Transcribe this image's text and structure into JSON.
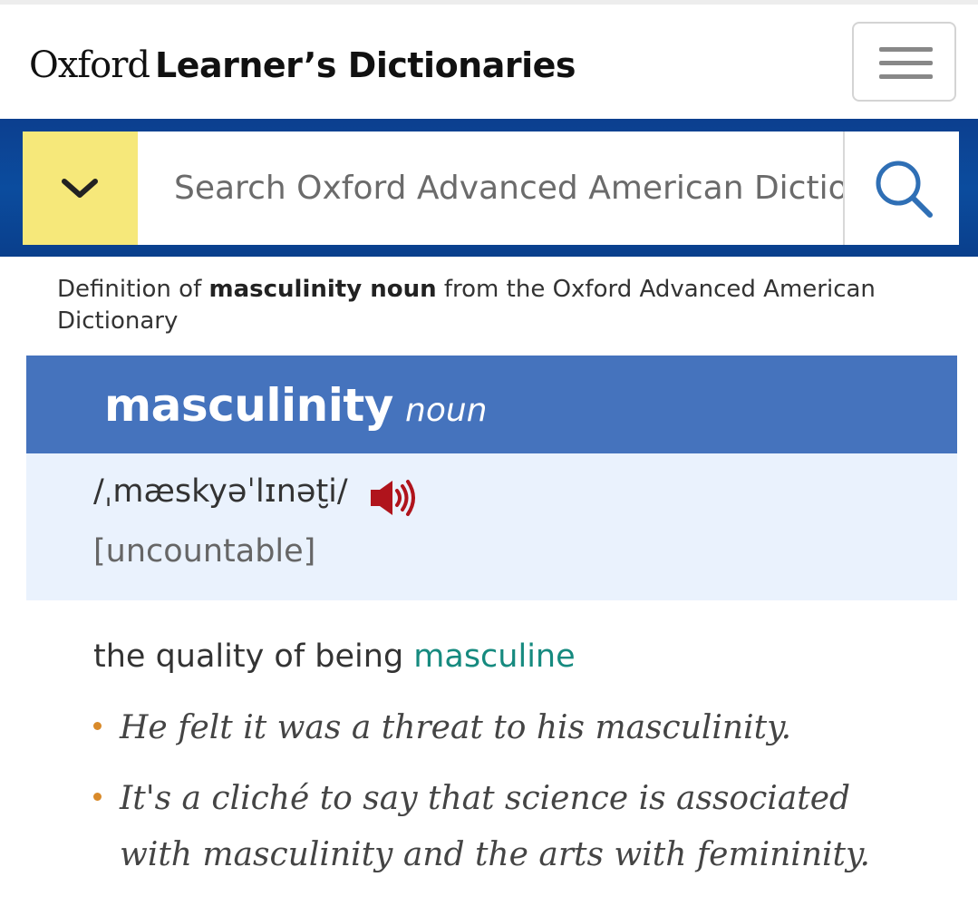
{
  "header": {
    "logo_oxford": "Oxford",
    "logo_rest": "Learner’s Dictionaries",
    "menu_icon": "hamburger-menu-icon"
  },
  "search": {
    "placeholder": "Search Oxford Advanced American Dictionary",
    "dictionary_select_icon": "chevron-down-icon",
    "search_icon": "magnifier-icon"
  },
  "definition_source": {
    "prefix": "Definition of ",
    "headword_pos": "masculinity noun",
    "suffix": " from the Oxford Advanced American Dictionary"
  },
  "entry": {
    "headword": "masculinity",
    "pos": "noun",
    "phonetic": "/ˌmæskyəˈlɪnət̮i/",
    "audio_icon": "speaker-icon",
    "grammar": "[uncountable]",
    "sense": {
      "text": "the quality of being ",
      "link": "masculine"
    },
    "examples": [
      "He felt it was a threat to his masculinity.",
      "It's a cliché to say that science is associated with masculinity and the arts with femininity."
    ]
  },
  "colors": {
    "brand_blue": "#0b4c9e",
    "headword_bar": "#4573bd",
    "pron_box": "#eaf2fd",
    "select_yellow": "#f6e87a",
    "link_teal": "#168a7f",
    "bullet_orange": "#d98a2a",
    "speaker_red": "#b0141c"
  }
}
